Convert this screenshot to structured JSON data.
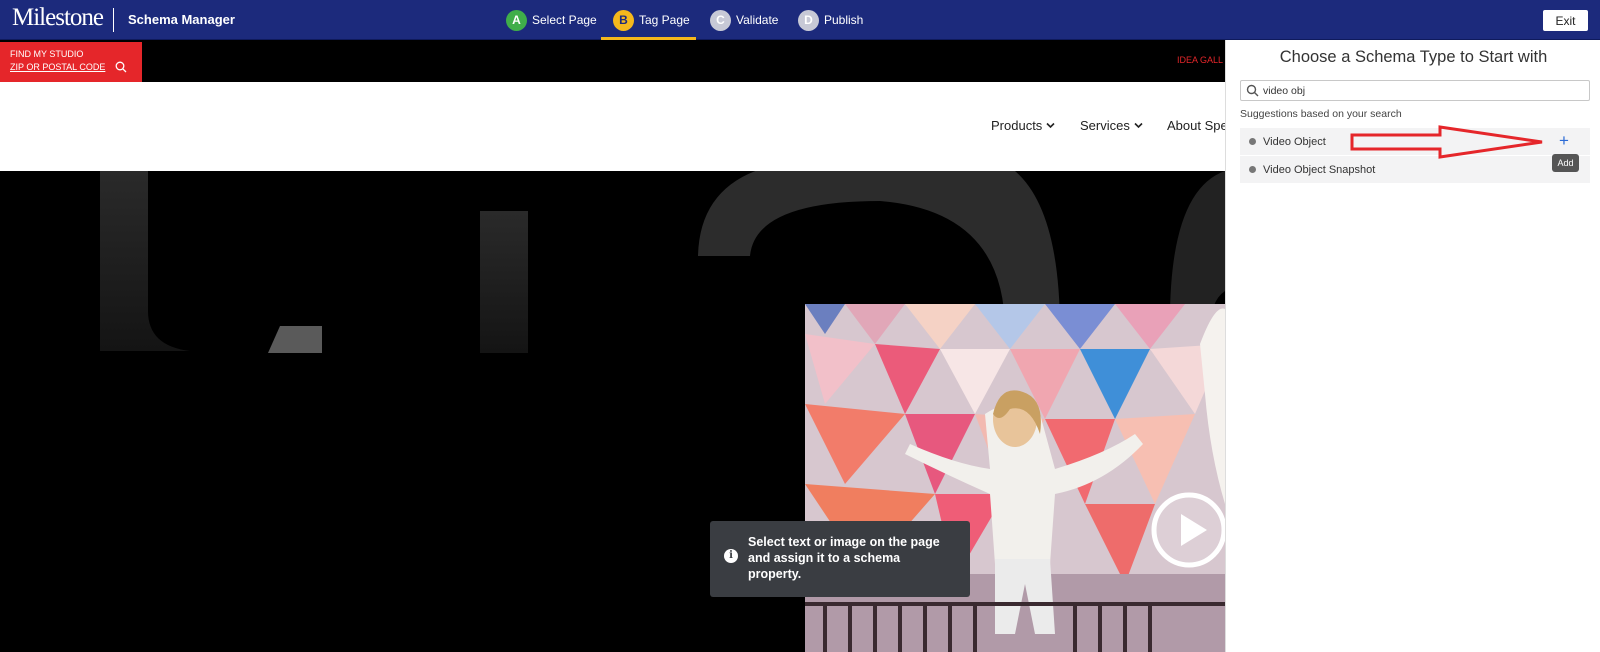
{
  "header": {
    "logo": "Milestone",
    "app_name": "Schema Manager",
    "steps": [
      {
        "letter": "A",
        "label": "Select Page"
      },
      {
        "letter": "B",
        "label": "Tag Page"
      },
      {
        "letter": "C",
        "label": "Validate"
      },
      {
        "letter": "D",
        "label": "Publish"
      }
    ],
    "active_step": "B",
    "exit_label": "Exit"
  },
  "site": {
    "find_studio_line1": "FIND MY STUDIO",
    "find_studio_line2": "ZIP OR POSTAL CODE",
    "top_link": "IDEA GALL",
    "nav": [
      "Products",
      "Services",
      "About Spe"
    ],
    "tooltip": "Select text or image on the page and assign it to a schema property."
  },
  "panel": {
    "title": "Choose a Schema Type to Start with",
    "search_value": "video obj",
    "suggestions_label": "Suggestions based on your search",
    "results": [
      "Video Object",
      "Video Object Snapshot"
    ],
    "add_icon": "+",
    "add_tooltip": "Add"
  },
  "colors": {
    "header_bg": "#1c2a7c",
    "active_step": "#f5b81c",
    "step_a": "#3fae4a",
    "brand_red": "#e5262a",
    "add_blue": "#2b6bd6"
  },
  "icons": [
    "search-icon",
    "chevron-down-icon",
    "info-icon",
    "plus-icon",
    "play-icon",
    "red-arrow-annotation"
  ]
}
